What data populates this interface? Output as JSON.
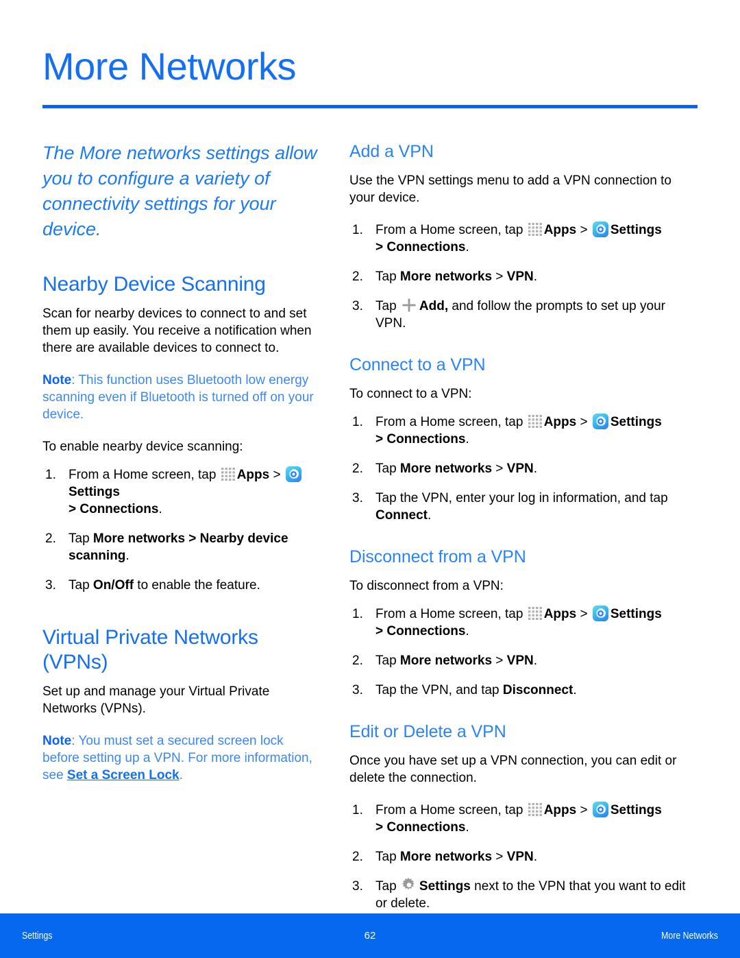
{
  "page": {
    "title": "More Networks",
    "accent_color": "#1470f0",
    "footer_color": "#0568ee",
    "note_color": "#3b88f5"
  },
  "intro": "The More networks settings allow you to configure a variety of connectivity settings for your device.",
  "left_column": {
    "nearby": {
      "heading": "Nearby Device Scanning",
      "body": "Scan for nearby devices to connect to and set them up easily. You receive a notification when there are available devices to connect to.",
      "note_label": "Note",
      "note_body": ": This function uses Bluetooth low energy scanning even if Bluetooth is turned off on your device.",
      "lead": "To enable nearby device scanning:",
      "steps": [
        {
          "num": "1.",
          "pre": "From a Home screen, tap ",
          "apps_label": "Apps",
          "sep": " > ",
          "settings_label": "Settings",
          "post_bold": "> Connections",
          "post_tail": "."
        },
        {
          "num": "2.",
          "pre": "Tap ",
          "bold1": "More networks",
          "mid": " > ",
          "bold2": "Nearby device scanning",
          "tail": "."
        },
        {
          "num": "3.",
          "pre": "Tap ",
          "bold1": "On/Off",
          "tail": " to enable the feature."
        }
      ]
    },
    "vpn": {
      "heading": "Virtual Private Networks (VPNs)",
      "body": "Set up and manage your Virtual Private Networks (VPNs).",
      "note_label": "Note",
      "note_body_1": ": You must set a secured screen lock before setting up a VPN. For more information, see ",
      "note_link": "Set a Screen Lock",
      "note_body_2": "."
    }
  },
  "right_column": {
    "add_vpn": {
      "heading": "Add a VPN",
      "body": "Use the VPN settings menu to add a VPN connection to your device.",
      "steps": [
        {
          "num": "1.",
          "pre": "From a Home screen, tap ",
          "apps_label": "Apps",
          "sep": " > ",
          "settings_label": "Settings",
          "post_bold": "> Connections",
          "post_tail": "."
        },
        {
          "num": "2.",
          "pre": "Tap ",
          "bold1": "More networks",
          "mid": " > ",
          "bold2": "VPN",
          "tail": "."
        },
        {
          "num": "3.",
          "pre": "Tap ",
          "bold1": "Add,",
          "tail": " and follow the prompts to set up your VPN."
        }
      ]
    },
    "connect_vpn": {
      "heading": "Connect to a VPN",
      "lead": "To connect to a VPN:",
      "steps": [
        {
          "num": "1.",
          "pre": "From a Home screen, tap ",
          "apps_label": "Apps",
          "sep": " > ",
          "settings_label": "Settings",
          "post_bold": "> Connections",
          "post_tail": "."
        },
        {
          "num": "2.",
          "pre": "Tap ",
          "bold1": "More networks",
          "mid": " > ",
          "bold2": "VPN",
          "tail": "."
        },
        {
          "num": "3.",
          "pre": "Tap the VPN, enter your log in information, and tap ",
          "bold1": "Connect",
          "tail": "."
        }
      ]
    },
    "disconnect_vpn": {
      "heading": "Disconnect from a VPN",
      "lead": "To disconnect from a VPN:",
      "steps": [
        {
          "num": "1.",
          "pre": "From a Home screen, tap ",
          "apps_label": "Apps",
          "sep": " > ",
          "settings_label": "Settings",
          "post_bold": "> Connections",
          "post_tail": "."
        },
        {
          "num": "2.",
          "pre": "Tap ",
          "bold1": "More networks",
          "mid": " > ",
          "bold2": "VPN",
          "tail": "."
        },
        {
          "num": "3.",
          "pre": "Tap the VPN, and tap ",
          "bold1": "Disconnect",
          "tail": "."
        }
      ]
    },
    "edit_delete_vpn": {
      "heading": "Edit or Delete a VPN",
      "body": "Once you have set up a VPN connection, you can edit or delete the connection.",
      "steps": [
        {
          "num": "1.",
          "pre": "From a Home screen, tap ",
          "apps_label": "Apps",
          "sep": " > ",
          "settings_label": "Settings",
          "post_bold": "> Connections",
          "post_tail": "."
        },
        {
          "num": "2.",
          "pre": "Tap ",
          "bold1": "More networks",
          "mid": " > ",
          "bold2": "VPN",
          "tail": "."
        },
        {
          "num": "3.",
          "pre": "Tap ",
          "bold1": "Settings",
          "tail": " next to the VPN that you want to edit or delete."
        }
      ]
    }
  },
  "footer": {
    "left": "Settings",
    "page_number": "62",
    "right": "More Networks"
  }
}
